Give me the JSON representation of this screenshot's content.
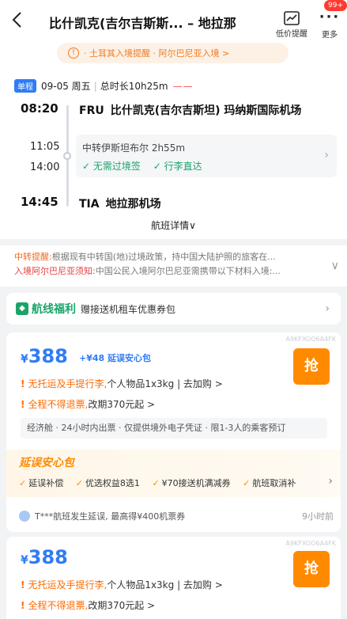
{
  "header": {
    "back_icon": "back-arrow-icon",
    "title": "比什凯克(吉尔吉斯斯... – 地拉那",
    "price_alert_label": "低价提醒",
    "more_label": "更多",
    "badge": "99+",
    "notice": "· 土耳其入境提醒 · 阿尔巴尼亚入境 >",
    "notice_icon": "info-icon"
  },
  "itinerary": {
    "trip_type": "单程",
    "date": "09-05 周五",
    "duration": "总时长10h25m",
    "dep_time": "08:20",
    "dep_code": "FRU",
    "dep_airport": "比什凯克(吉尔吉斯坦) 玛纳斯国际机场",
    "transfer_arr_time": "11:05",
    "transfer_dep_time": "14:00",
    "transfer_city": "中转伊斯坦布尔 2h55m",
    "transfer_tags": [
      "✓ 无需过境签",
      "✓ 行李直达"
    ],
    "arr_time": "14:45",
    "arr_code": "TIA",
    "arr_airport": "地拉那机场",
    "detail_link": "航班详情∨"
  },
  "notes": {
    "transfer_label": "中转提醒:",
    "transfer_text": "根据现有中转国(地)过境政策，持中国大陆护照的旅客在...",
    "entry_label": "入境阿尔巴尼亚须知:",
    "entry_text": "中国公民入境阿尔巴尼亚需携带以下材料入境:..."
  },
  "benefit": {
    "title": "航线福利",
    "text": "赠接送机租车优惠券包"
  },
  "fares": [
    {
      "code": "A9KFXOO6A4FK",
      "price": "388",
      "currency": "¥",
      "plus": "+¥48 延误安心包",
      "grab": "抢",
      "cond1_warn": "无托运及手提行李,",
      "cond1_rest": "个人物品1x3kg | 去加购 >",
      "cond2_warn": "全程不得退票,",
      "cond2_rest": "改期370元起 >",
      "cabin": "经济舱 · 24小时内出票 · 仅提供境外电子凭证 · 限1-3人的乘客预订",
      "promo_title": "延误安心包",
      "promo_items": [
        "延误补偿",
        "优选权益8选1",
        "¥70接送机满减券",
        "航班取消补"
      ],
      "delay_note": "T***航班发生延误, 最高得¥400机票券",
      "delay_time": "9小时前"
    },
    {
      "code": "A9KFXOO6A4FK",
      "price": "388",
      "currency": "¥",
      "grab": "抢",
      "cond1_warn": "无托运及手提行李,",
      "cond1_rest": "个人物品1x3kg | 去加购 >",
      "cond2_warn": "全程不得退票,",
      "cond2_rest": "改期370元起 >"
    }
  ]
}
